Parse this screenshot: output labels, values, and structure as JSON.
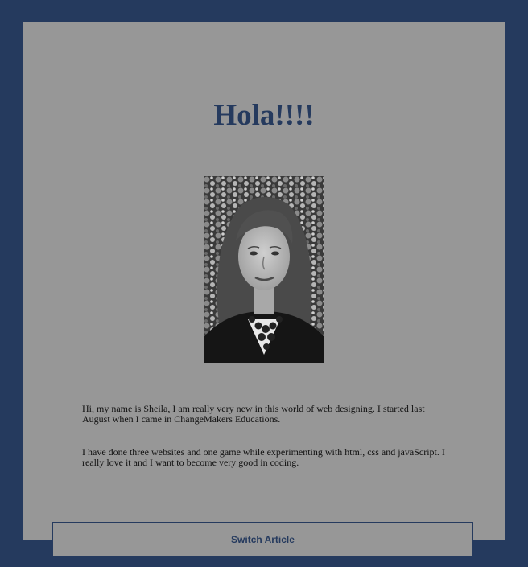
{
  "page": {
    "title": "Hola!!!!",
    "photo_alt": "Portrait photo of Sheila",
    "paragraphs": [
      "Hi, my name is Sheila, I am really very new in this world of web designing. I started last August when I came in ChangeMakers Educations.",
      "I have done three websites and one game while experimenting with html, css and javaScript. I really love it and I want to become very good in coding."
    ],
    "switch_button_label": "Switch Article"
  },
  "colors": {
    "frame": "#253a5e",
    "card": "#979797",
    "title": "#253a5e"
  }
}
